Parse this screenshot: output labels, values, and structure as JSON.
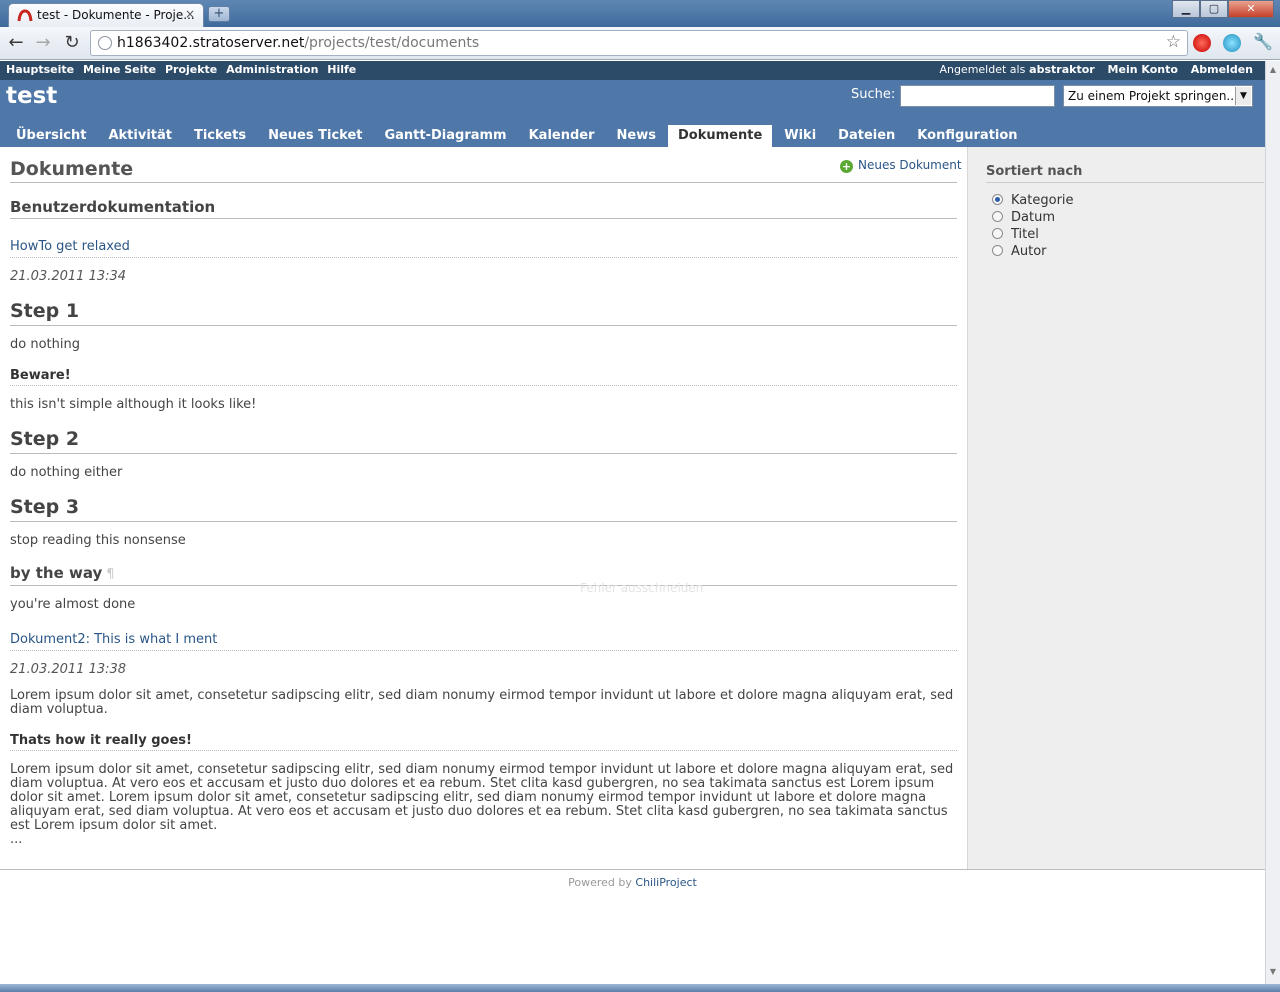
{
  "browser": {
    "tab_title": "test - Dokumente - Proje...",
    "tab_close": "×",
    "new_tab": "+",
    "window_minimize": "▁",
    "window_maximize": "▢",
    "window_close": "✕",
    "url_host": "h1863402.stratoserver.net",
    "url_path": "/projects/test/documents"
  },
  "topmenu": {
    "items": [
      "Hauptseite",
      "Meine Seite",
      "Projekte",
      "Administration",
      "Hilfe"
    ],
    "logged_in_prefix": "Angemeldet als",
    "username": "abstraktor",
    "account": "Mein Konto",
    "logout": "Abmelden"
  },
  "header": {
    "project_title": "test",
    "search_label": "Suche:",
    "jump_select": "Zu einem Projekt springen..."
  },
  "mainmenu": {
    "items": [
      "Übersicht",
      "Aktivität",
      "Tickets",
      "Neues Ticket",
      "Gantt-Diagramm",
      "Kalender",
      "News",
      "Dokumente",
      "Wiki",
      "Dateien",
      "Konfiguration"
    ],
    "selected": "Dokumente"
  },
  "content": {
    "title": "Dokumente",
    "new_document": "Neues Dokument",
    "category": "Benutzerdokumentation",
    "doc1": {
      "link": "HowTo get relaxed",
      "date": "21.03.2011 13:34",
      "step1": "Step 1",
      "step1_text": "do nothing",
      "beware": "Beware!",
      "beware_text": "this isn't simple although it looks like!",
      "step2": "Step 2",
      "step2_text": "do nothing either",
      "step3": "Step 3",
      "step3_text": "stop reading this nonsense",
      "bytheway": "by the way",
      "pilcrow": "¶",
      "bytheway_text": "you're almost done"
    },
    "ghost_text": "Fehler ausschneiden",
    "doc2": {
      "link": "Dokument2: This is what I ment",
      "date": "21.03.2011 13:38",
      "para1": "Lorem ipsum dolor sit amet, consetetur sadipscing elitr, sed diam nonumy eirmod tempor invidunt ut labore et dolore magna aliquyam erat, sed diam voluptua.",
      "heading": "Thats how it really goes!",
      "para2": "Lorem ipsum dolor sit amet, consetetur sadipscing elitr, sed diam nonumy eirmod tempor invidunt ut labore et dolore magna aliquyam erat, sed diam voluptua. At vero eos et accusam et justo duo dolores et ea rebum. Stet clita kasd gubergren, no sea takimata sanctus est Lorem ipsum dolor sit amet. Lorem ipsum dolor sit amet, consetetur sadipscing elitr, sed diam nonumy eirmod tempor invidunt ut labore et dolore magna aliquyam erat, sed diam voluptua. At vero eos et accusam et justo duo dolores et ea rebum. Stet clita kasd gubergren, no sea takimata sanctus est Lorem ipsum dolor sit amet.",
      "ellipsis": "..."
    }
  },
  "sidebar": {
    "title": "Sortiert nach",
    "options": [
      "Kategorie",
      "Datum",
      "Titel",
      "Autor"
    ],
    "selected": "Kategorie"
  },
  "footer": {
    "powered_by": "Powered by",
    "link": "ChiliProject"
  },
  "icons": {
    "back": "back-arrow-icon",
    "forward": "forward-arrow-icon",
    "reload": "reload-icon",
    "star": "bookmark-star-icon",
    "wrench": "wrench-icon",
    "new_document": "add-icon"
  },
  "glyphs": {
    "back": "←",
    "forward": "→",
    "reload": "↻",
    "star": "☆",
    "wrench": "🔧",
    "plus": "+",
    "select_arrow": "▼",
    "sb_up": "▲",
    "sb_down": "▼"
  },
  "colors": {
    "header_blue": "#4f77a8",
    "topmenu_blue": "#2c4b68",
    "link": "#2a5685",
    "sidebar_bg": "#eeeeee"
  }
}
